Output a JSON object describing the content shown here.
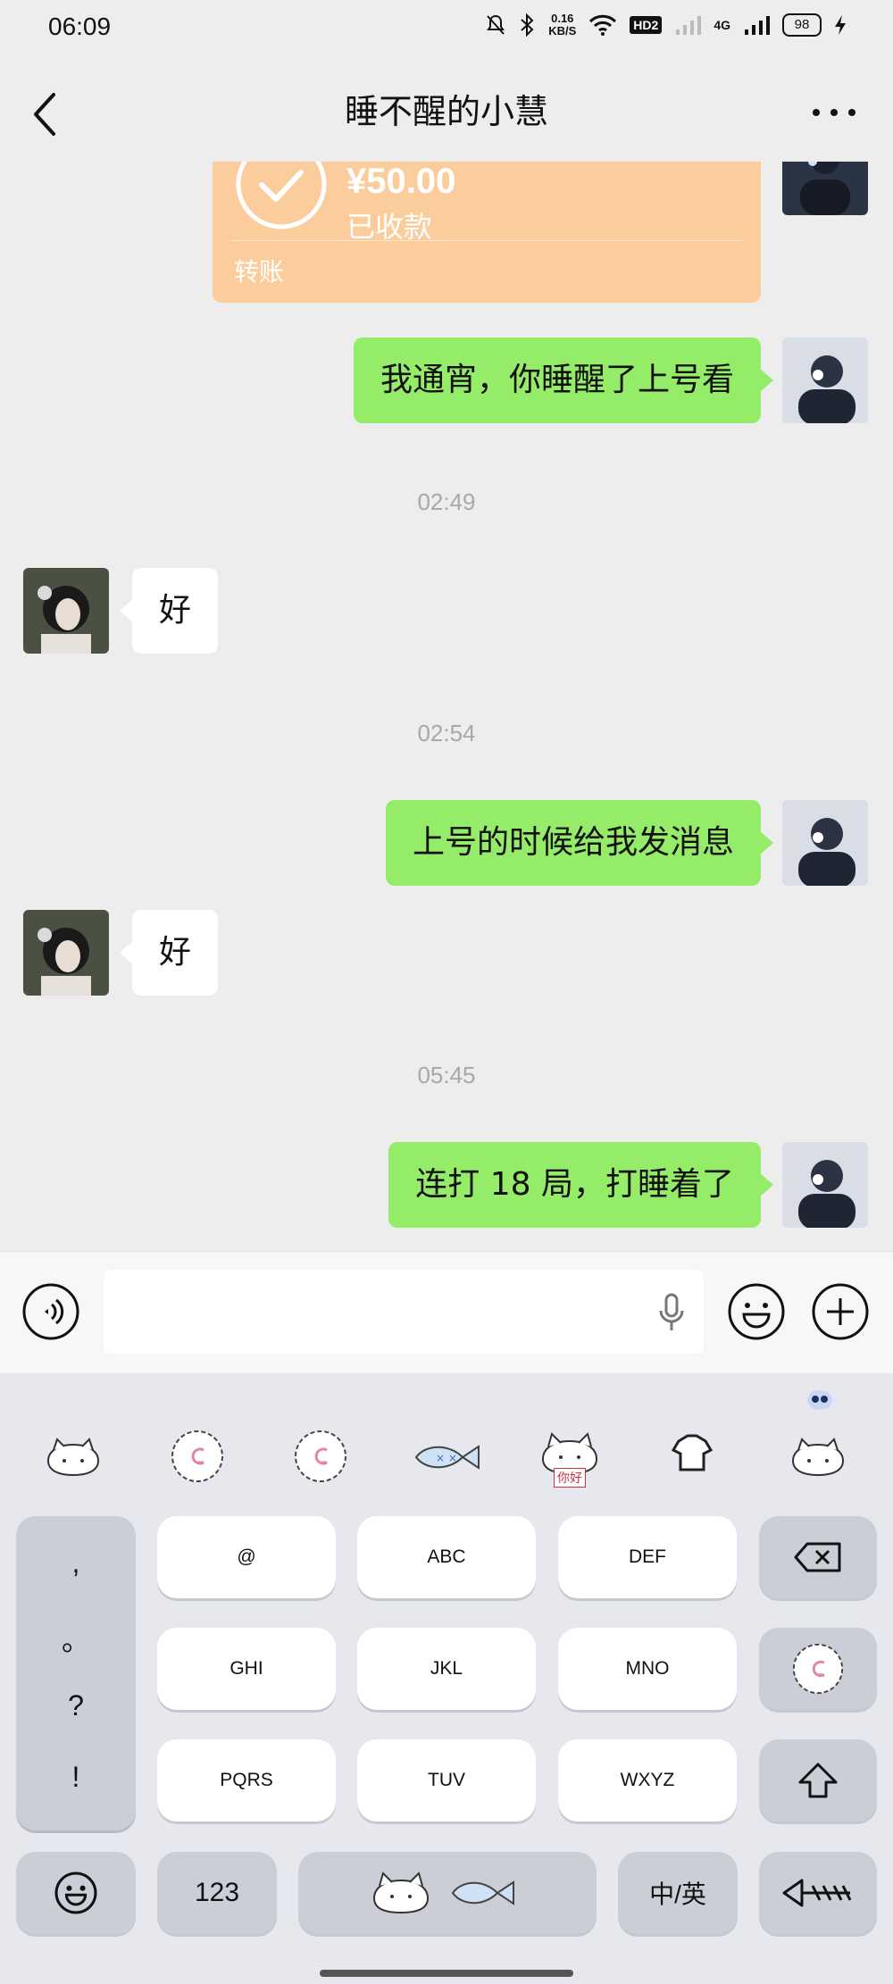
{
  "status_bar": {
    "time": "06:09",
    "speed_top": "0.16",
    "speed_bottom": "KB/S",
    "hd_label": "HD2",
    "network": "4G",
    "battery": "98"
  },
  "header": {
    "title": "睡不醒的小慧"
  },
  "transfer": {
    "amount": "¥50.00",
    "status": "已收款",
    "label": "转账"
  },
  "messages": [
    {
      "text": "我通宵，你睡醒了上号看"
    },
    {
      "text": "好"
    },
    {
      "text": "上号的时候给我发消息"
    },
    {
      "text": "好"
    },
    {
      "text": "连打 18 局，打睡着了"
    }
  ],
  "timestamps": [
    "02:49",
    "02:54",
    "05:45"
  ],
  "keyboard": {
    "punctuation": [
      ",",
      "。",
      "?",
      "!"
    ],
    "keys": [
      "@",
      "ABC",
      "DEF",
      "GHI",
      "JKL",
      "MNO",
      "PQRS",
      "TUV",
      "WXYZ"
    ],
    "num_key": "123",
    "lang_key": "中/英",
    "sticker_caption": "你好"
  },
  "colors": {
    "my_bubble": "#95ec69",
    "transfer_card": "#fbcd9c",
    "background": "#ededed"
  }
}
